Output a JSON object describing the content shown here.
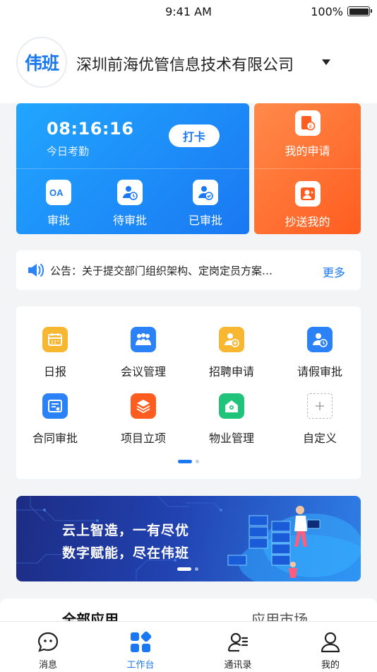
{
  "status_bar": {
    "time": "9:41 AM",
    "battery": "100%"
  },
  "header": {
    "logo_text": "伟班",
    "company": "深圳前海优管信息技术有限公司"
  },
  "attendance": {
    "time": "08:16:16",
    "label": "今日考勤",
    "punch_button": "打卡",
    "items": [
      {
        "label": "审批",
        "icon": "oa-icon"
      },
      {
        "label": "待审批",
        "icon": "pending-approval-icon"
      },
      {
        "label": "已审批",
        "icon": "approved-icon"
      }
    ]
  },
  "requests": {
    "items": [
      {
        "label": "我的申请",
        "icon": "my-application-icon"
      },
      {
        "label": "抄送我的",
        "icon": "cc-to-me-icon"
      }
    ]
  },
  "notice": {
    "text": "公告：关于提交部门组织架构、定岗定员方案…",
    "more": "更多"
  },
  "apps": {
    "items": [
      {
        "label": "日报",
        "icon": "calendar-icon",
        "color": "#f7b731"
      },
      {
        "label": "会议管理",
        "icon": "meeting-icon",
        "color": "#2a82f6"
      },
      {
        "label": "招聘申请",
        "icon": "recruit-icon",
        "color": "#f7b731"
      },
      {
        "label": "请假审批",
        "icon": "leave-icon",
        "color": "#2a82f6"
      },
      {
        "label": "合同审批",
        "icon": "contract-icon",
        "color": "#2a82f6"
      },
      {
        "label": "项目立项",
        "icon": "layers-icon",
        "color": "#ff5d1f"
      },
      {
        "label": "物业管理",
        "icon": "property-icon",
        "color": "#1fc37a"
      },
      {
        "label": "自定义",
        "icon": "plus-icon",
        "color": "#b5b9c0"
      }
    ]
  },
  "banner": {
    "line1": "云上智造，一有尽优",
    "line2": "数字赋能，尽在伟班"
  },
  "section_tabs": {
    "all_apps": "全部应用",
    "app_market": "应用市场"
  },
  "tab_bar": {
    "items": [
      {
        "label": "消息",
        "icon": "message-icon"
      },
      {
        "label": "工作台",
        "icon": "workbench-icon"
      },
      {
        "label": "通讯录",
        "icon": "contacts-icon"
      },
      {
        "label": "我的",
        "icon": "profile-icon"
      }
    ]
  },
  "colors": {
    "primary": "#1a78f2",
    "orange": "#ff5d1f"
  }
}
